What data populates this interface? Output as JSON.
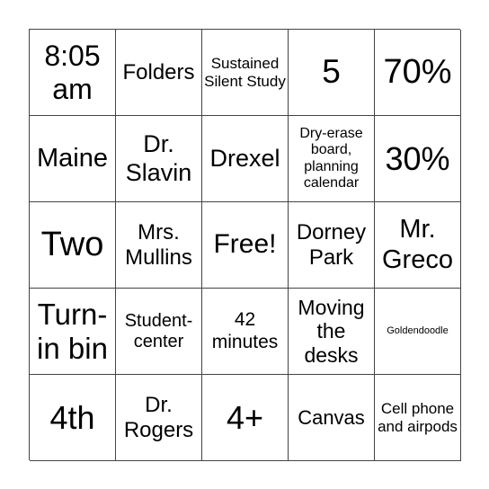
{
  "cells": [
    "8:05 am",
    "Folders",
    "Sustained Silent Study",
    "5",
    "70%",
    "Maine",
    "Dr. Slavin",
    "Drexel",
    "Dry-erase board, planning calendar",
    "30%",
    "Two",
    "Mrs. Mullins",
    "Free!",
    "Dorney Park",
    "Mr. Greco",
    "Turn-in bin",
    "Student-center",
    "42 minutes",
    "Moving the desks",
    "Goldendoodle",
    "4th",
    "Dr. Rogers",
    "4+",
    "Canvas",
    "Cell phone and airpods"
  ]
}
